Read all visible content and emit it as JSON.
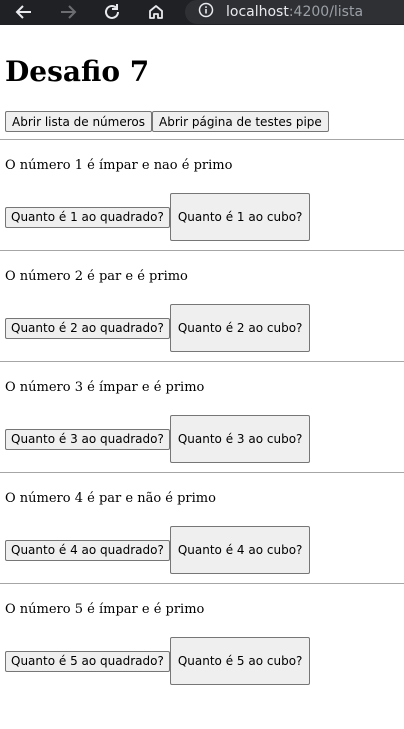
{
  "browser": {
    "url_host": "localhost",
    "url_rest": ":4200/lista"
  },
  "page": {
    "title": "Desafio 7",
    "actions": {
      "list_button": "Abrir lista de números",
      "pipe_button": "Abrir página de testes pipe"
    },
    "numbers": [
      {
        "text": "O número 1 é ímpar e nao é primo",
        "square_label": "Quanto é 1 ao quadrado?",
        "cube_label": "Quanto é 1 ao cubo?"
      },
      {
        "text": "O número 2 é par e é primo",
        "square_label": "Quanto é 2 ao quadrado?",
        "cube_label": "Quanto é 2 ao cubo?"
      },
      {
        "text": "O número 3 é ímpar e é primo",
        "square_label": "Quanto é 3 ao quadrado?",
        "cube_label": "Quanto é 3 ao cubo?"
      },
      {
        "text": "O número 4 é par e não é primo",
        "square_label": "Quanto é 4 ao quadrado?",
        "cube_label": "Quanto é 4 ao cubo?"
      },
      {
        "text": "O número 5 é ímpar e é primo",
        "square_label": "Quanto é 5 ao quadrado?",
        "cube_label": "Quanto é 5 ao cubo?"
      }
    ]
  }
}
